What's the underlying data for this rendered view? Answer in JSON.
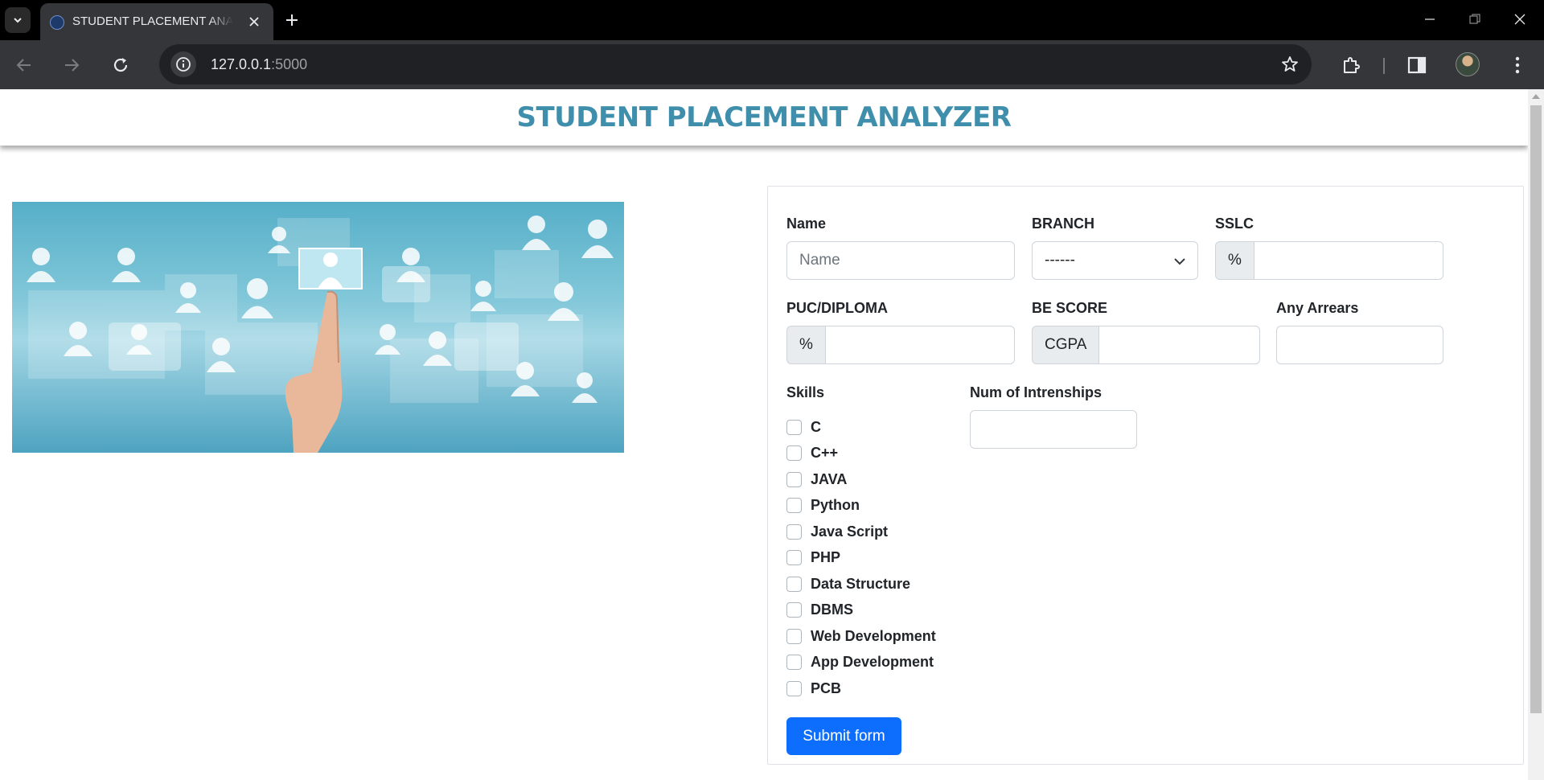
{
  "browser": {
    "tab_title": "STUDENT PLACEMENT ANALYZER",
    "url_host": "127.0.0.1",
    "url_port": ":5000"
  },
  "page": {
    "title": "STUDENT PLACEMENT ANALYZER"
  },
  "form": {
    "name": {
      "label": "Name",
      "placeholder": "Name",
      "value": ""
    },
    "branch": {
      "label": "BRANCH",
      "value": "------"
    },
    "sslc": {
      "label": "SSLC",
      "addon": "%",
      "value": ""
    },
    "puc": {
      "label": "PUC/DIPLOMA",
      "addon": "%",
      "value": ""
    },
    "be_score": {
      "label": "BE SCORE",
      "addon": "CGPA",
      "value": ""
    },
    "arrears": {
      "label": "Any Arrears",
      "value": ""
    },
    "skills_label": "Skills",
    "skills": [
      "C",
      "C++",
      "JAVA",
      "Python",
      "Java Script",
      "PHP",
      "Data Structure",
      "DBMS",
      "Web Development",
      "App Development",
      "PCB"
    ],
    "internships": {
      "label": "Num of Intrenships",
      "value": ""
    },
    "submit_label": "Submit form"
  },
  "colors": {
    "title": "#3f8fac",
    "primary": "#0d6efd",
    "chrome_dark": "#35363a"
  },
  "icons": [
    "tab-list-icon",
    "favicon-icon",
    "close-icon",
    "plus-icon",
    "minimize-icon",
    "restore-icon",
    "back-arrow-icon",
    "forward-arrow-icon",
    "reload-icon",
    "site-info-icon",
    "star-icon",
    "extensions-icon",
    "side-panel-icon",
    "profile-avatar",
    "kebab-menu-icon",
    "chevron-down-icon"
  ]
}
